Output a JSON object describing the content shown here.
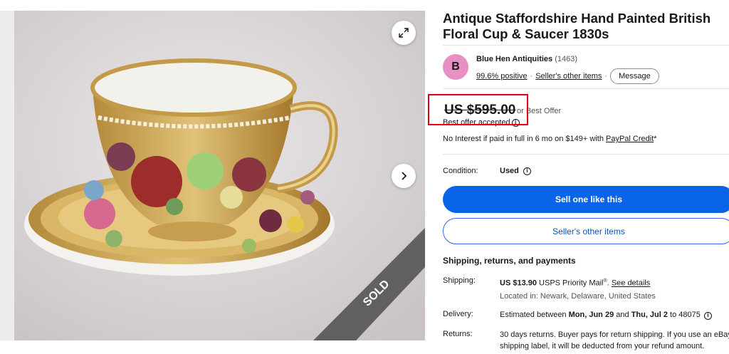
{
  "listing": {
    "title": "Antique Staffordshire Hand Painted British Floral Cup & Saucer 1830s",
    "sold_ribbon": "SOLD"
  },
  "seller": {
    "avatar_letter": "B",
    "name": "Blue Hen Antiquities",
    "feedback_count": "(1463)",
    "positive": "99.6% positive",
    "other_items": "Seller's other items",
    "message": "Message"
  },
  "pricing": {
    "price": "US $595.00",
    "or_best_offer": "or Best Offer",
    "offer_accepted": "Best offer accepted",
    "interest_prefix": "No Interest if paid in full in 6 mo on $149+ with ",
    "interest_link": "PayPal Credit",
    "interest_suffix": "*"
  },
  "condition": {
    "label": "Condition:",
    "value": "Used"
  },
  "actions": {
    "sell_one": "Sell one like this",
    "sellers_other_items": "Seller's other items"
  },
  "shipping": {
    "heading": "Shipping, returns, and payments",
    "shipping_label": "Shipping:",
    "shipping_price": "US $13.90",
    "shipping_service": " USPS Priority Mail",
    "registered": "®",
    "shipping_details": "See details",
    "location": "Located in: Newark, Delaware, United States",
    "delivery_label": "Delivery:",
    "delivery_prefix": "Estimated between ",
    "delivery_dates": "Mon, Jun 29",
    "delivery_and": " and ",
    "delivery_dates2": "Thu, Jul 2",
    "delivery_suffix": " to 48075",
    "returns_label": "Returns:",
    "returns_text": "30 days returns. Buyer pays for return shipping. If you use an eBay shipping label, it will be deducted from your refund amount."
  },
  "colors": {
    "primary_button": "#0a64e8",
    "highlight": "#e60012",
    "avatar": "#e88fc3"
  }
}
